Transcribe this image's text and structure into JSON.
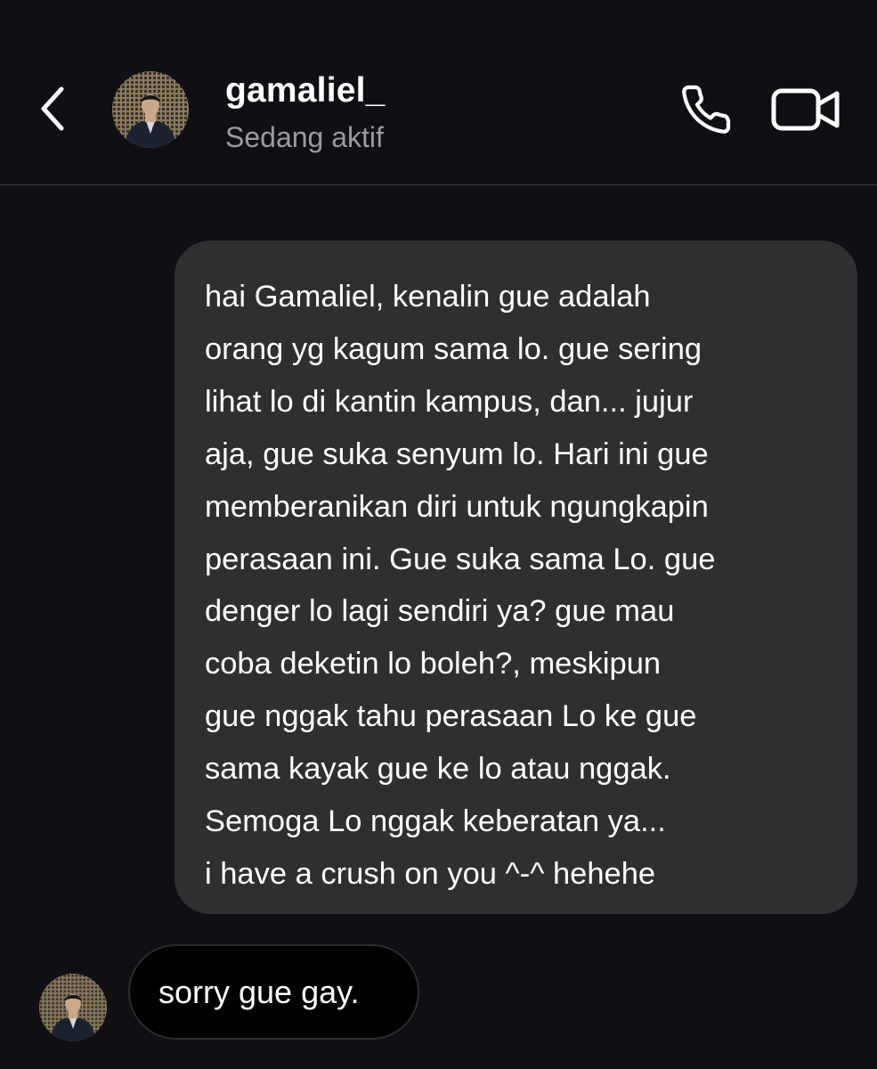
{
  "header": {
    "username": "gamaliel_",
    "status": "Sedang aktif",
    "icons": {
      "back": "chevron-left-icon",
      "call": "phone-icon",
      "video": "video-camera-icon"
    }
  },
  "messages": [
    {
      "direction": "sent",
      "lines": [
        "hai Gamaliel, kenalin gue adalah",
        "orang yg kagum sama lo. gue sering",
        "lihat lo di kantin kampus, dan... jujur",
        "aja, gue suka senyum lo. Hari ini gue",
        "memberanikan diri untuk ngungkapin",
        "perasaan ini. Gue suka sama Lo. gue",
        "denger lo lagi sendiri ya? gue mau",
        "coba deketin lo boleh?, meskipun",
        "gue nggak tahu perasaan Lo ke gue",
        "sama kayak gue ke lo atau nggak.",
        "Semoga Lo nggak keberatan ya...",
        "i have a crush on you ^-^ hehehe"
      ]
    },
    {
      "direction": "received",
      "text": "sorry gue gay."
    }
  ],
  "colors": {
    "background": "#0f0f14",
    "sent_bubble": "#2f2f31",
    "received_bubble": "#000000",
    "status_text": "#9a9aa2"
  }
}
